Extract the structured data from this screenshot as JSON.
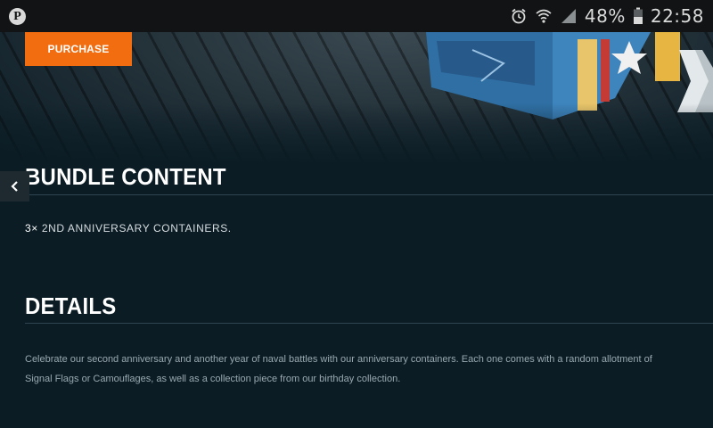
{
  "status_bar": {
    "battery_percent": "48%",
    "time": "22:58",
    "icons": [
      "pinterest-icon",
      "alarm-icon",
      "wifi-icon",
      "signal-icon",
      "battery-icon"
    ]
  },
  "hero": {
    "purchase_label": "PURCHASE",
    "accent_color": "#f26c10"
  },
  "bundle": {
    "title": "BUNDLE CONTENT",
    "quantity": "3×",
    "item": "2ND ANNIVERSARY CONTAINERS."
  },
  "details": {
    "title": "DETAILS",
    "text": "Celebrate our second anniversary and another year of naval battles with our anniversary containers. Each one comes with a random allotment of Signal Flags or Camouflages, as well as a collection piece from our birthday collection."
  }
}
